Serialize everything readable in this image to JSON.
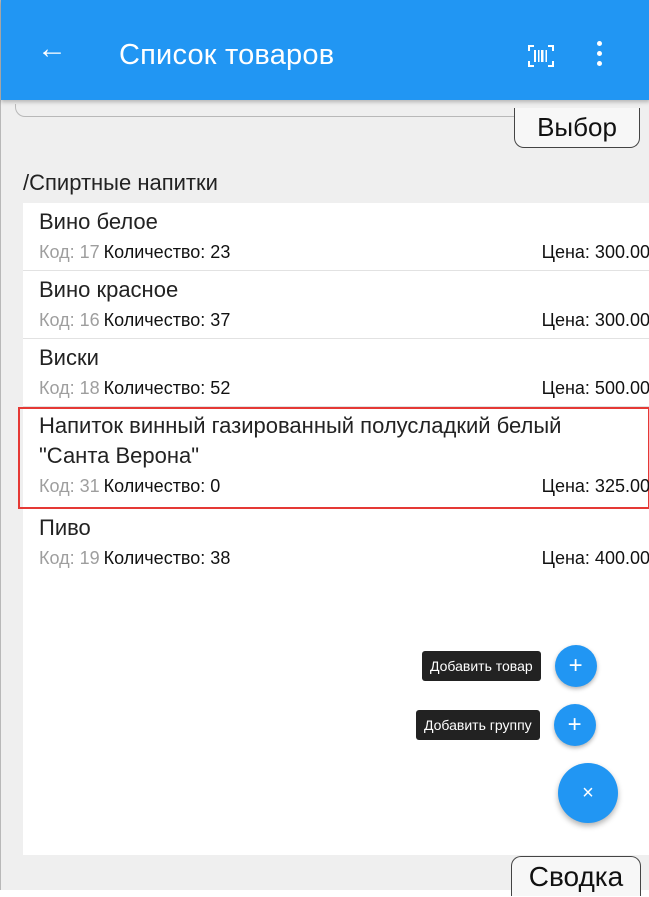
{
  "appbar": {
    "back_icon": "arrow-left-icon",
    "title": "Список товаров",
    "barcode_icon": "barcode-scan-icon",
    "more_icon": "more-vertical-icon",
    "color": "#2196f3"
  },
  "tabs": {
    "top_label": "Выбор",
    "bottom_label": "Сводка"
  },
  "path": "/Спиртные напитки",
  "items": [
    {
      "name": "Вино белое",
      "code": "Код: 17",
      "qty": "Количество: 23",
      "price": "Цена: 300.00"
    },
    {
      "name": "Вино красное",
      "code": "Код: 16",
      "qty": "Количество: 37",
      "price": "Цена: 300.00"
    },
    {
      "name": "Виски",
      "code": "Код: 18",
      "qty": "Количество: 52",
      "price": "Цена: 500.00"
    },
    {
      "name": "Напиток винный газированный полусладкий белый \"Санта Верона\"",
      "code": "Код: 31",
      "qty": "Количество: 0",
      "price": "Цена: 325.00",
      "selected": true
    },
    {
      "name": "Пиво",
      "code": "Код: 19",
      "qty": "Количество: 38",
      "price": "Цена: 400.00"
    }
  ],
  "fab": {
    "add_product_label": "Добавить товар",
    "add_group_label": "Добавить группу",
    "plus_glyph": "+",
    "close_glyph": "×"
  },
  "colors": {
    "selection": "#e53935",
    "accent": "#2196f3"
  }
}
